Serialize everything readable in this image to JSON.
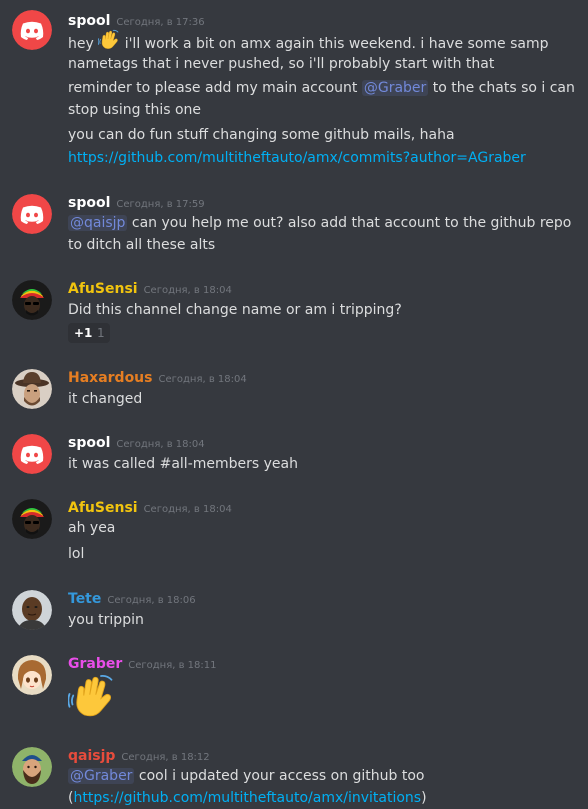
{
  "colors": {
    "background": "#36393f",
    "discord_avatar": "#f04747",
    "mention_text": "#7289da",
    "link": "#00b0f4",
    "timestamp": "#72767d"
  },
  "messages": [
    {
      "author": "spool",
      "author_color": "#ffffff",
      "avatar": "discord-logo-icon",
      "timestamp": "Сегодня, в 17:36",
      "lines": {
        "l1_pre": "hey",
        "l1_post": "i'll work a bit on amx again this weekend. i have some samp",
        "l2": "nametags that i never pushed, so i'll probably start with that",
        "l3_pre": "reminder to please add my main account",
        "l3_mention": "@Graber",
        "l3_post": "to the chats so i can",
        "l4": "stop using this one",
        "l5": "you can do fun stuff changing some github mails, haha",
        "l6_link": "https://github.com/multitheftauto/amx/commits?author=AGraber"
      }
    },
    {
      "author": "spool",
      "author_color": "#ffffff",
      "avatar": "discord-logo-icon",
      "timestamp": "Сегодня, в 17:59",
      "lines": {
        "l1_mention": "@qaisjp",
        "l1_post": "can you help me out? also add that account to the github repo",
        "l2": "to ditch all these alts"
      }
    },
    {
      "author": "AfuSensi",
      "author_color": "#f1c40f",
      "avatar": "rasta-avatar",
      "timestamp": "Сегодня, в 18:04",
      "lines": {
        "l1": "Did this channel change name or am i tripping?"
      },
      "reaction": {
        "emoji": "+1",
        "count": "1"
      }
    },
    {
      "author": "Haxardous",
      "author_color": "#e67e22",
      "avatar": "cowboy-avatar",
      "timestamp": "Сегодня, в 18:04",
      "lines": {
        "l1": "it changed"
      }
    },
    {
      "author": "spool",
      "author_color": "#ffffff",
      "avatar": "discord-logo-icon",
      "timestamp": "Сегодня, в 18:04",
      "lines": {
        "l1": "it was called #all-members yeah"
      }
    },
    {
      "author": "AfuSensi",
      "author_color": "#f1c40f",
      "avatar": "rasta-avatar",
      "timestamp": "Сегодня, в 18:04",
      "lines": {
        "l1": "ah yea",
        "l2": "lol"
      }
    },
    {
      "author": "Tete",
      "author_color": "#3498db",
      "avatar": "person-avatar",
      "timestamp": "Сегодня, в 18:06",
      "lines": {
        "l1": "you trippin"
      }
    },
    {
      "author": "Graber",
      "author_color": "#e94ee9",
      "avatar": "anime-girl-avatar",
      "timestamp": "Сегодня, в 18:11",
      "lines": {
        "emoji": "waving-hand-icon"
      }
    },
    {
      "author": "qaisjp",
      "author_color": "#e74c3c",
      "avatar": "bearded-man-avatar",
      "timestamp": "Сегодня, в 18:12",
      "lines": {
        "l1_mention": "@Graber",
        "l1_post": "cool i updated your access on github too",
        "l2_open": "(",
        "l2_link": "https://github.com/multitheftauto/amx/invitations",
        "l2_close": ")"
      }
    }
  ]
}
